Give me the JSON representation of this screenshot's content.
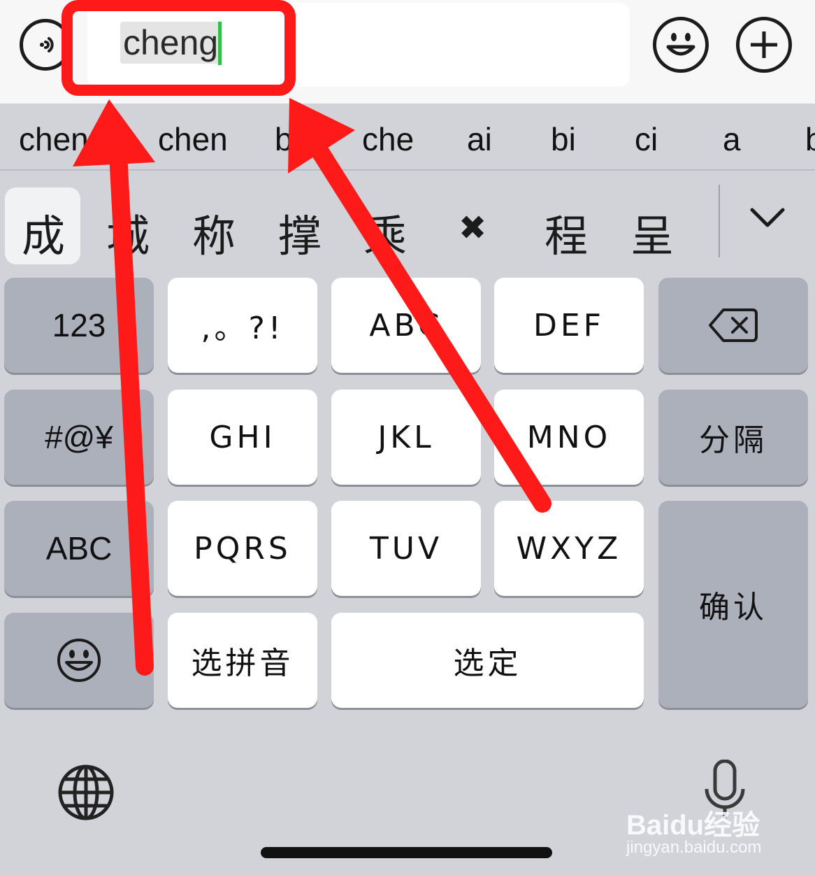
{
  "input": {
    "text": "cheng"
  },
  "pinyin_suggestions": [
    "chen",
    "chen",
    "b",
    "che",
    "ai",
    "bi",
    "ci",
    "a",
    "b"
  ],
  "hanzi_candidates": [
    "成",
    "城",
    "称",
    "撑",
    "乘",
    "程",
    "呈"
  ],
  "hanzi_delete_glyph": "✖",
  "keys": {
    "row1": [
      "123",
      ",。?!",
      "ABC",
      "DEF"
    ],
    "row2": [
      "#@¥",
      "GHI",
      "JKL",
      "MNO",
      "分隔"
    ],
    "row3": [
      "ABC",
      "PQRS",
      "TUV",
      "WXYZ"
    ],
    "row4": [
      "选拼音",
      "选定"
    ],
    "confirm": "确认"
  },
  "icons": {
    "voice": "voice-icon",
    "emoji": "emoji-icon",
    "plus": "plus-icon",
    "backspace": "backspace-icon",
    "collapse": "chevron-down-icon",
    "globe": "globe-icon",
    "mic": "microphone-icon"
  },
  "watermark": {
    "main": "Baidu经验",
    "sub": "jingyan.baidu.com"
  },
  "colors": {
    "annotation_red": "#ff1a1a",
    "caret_green": "#2fbf4a"
  }
}
